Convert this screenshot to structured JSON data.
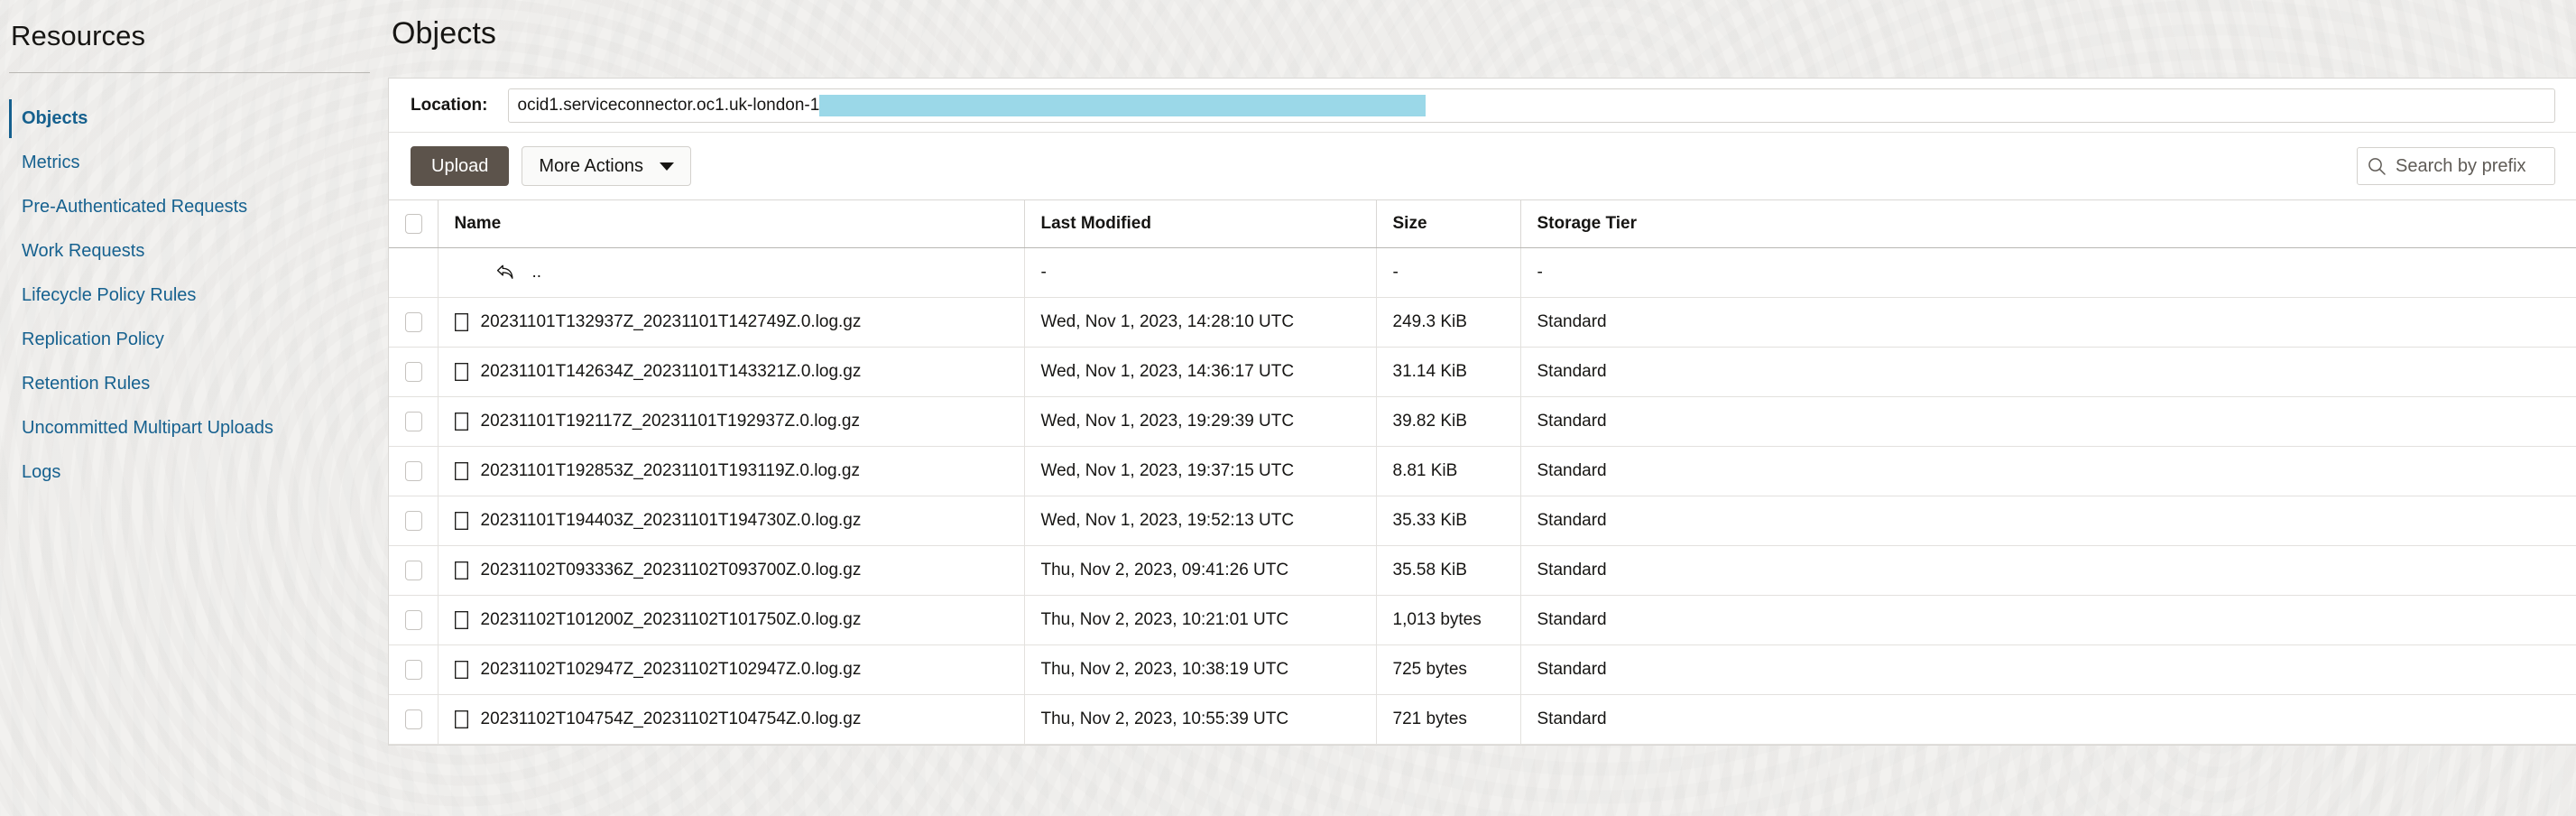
{
  "sidebar": {
    "title": "Resources",
    "items": [
      {
        "label": "Objects",
        "active": true
      },
      {
        "label": "Metrics",
        "active": false
      },
      {
        "label": "Pre-Authenticated Requests",
        "active": false
      },
      {
        "label": "Work Requests",
        "active": false
      },
      {
        "label": "Lifecycle Policy Rules",
        "active": false
      },
      {
        "label": "Replication Policy",
        "active": false
      },
      {
        "label": "Retention Rules",
        "active": false
      },
      {
        "label": "Uncommitted Multipart Uploads",
        "active": false
      },
      {
        "label": "Logs",
        "active": false
      }
    ]
  },
  "main": {
    "page_title": "Objects",
    "location": {
      "label": "Location:",
      "value": "ocid1.serviceconnector.oc1.uk-london-1",
      "redacted": true
    },
    "toolbar": {
      "upload_label": "Upload",
      "more_actions_label": "More Actions",
      "search_placeholder": "Search by prefix"
    },
    "table": {
      "columns": [
        "Name",
        "Last Modified",
        "Size",
        "Storage Tier"
      ],
      "parent_row": {
        "name": "..",
        "last_modified": "-",
        "size": "-",
        "storage_tier": "-"
      },
      "rows": [
        {
          "name": "20231101T132937Z_20231101T142749Z.0.log.gz",
          "last_modified": "Wed, Nov 1, 2023, 14:28:10 UTC",
          "size": "249.3 KiB",
          "storage_tier": "Standard"
        },
        {
          "name": "20231101T142634Z_20231101T143321Z.0.log.gz",
          "last_modified": "Wed, Nov 1, 2023, 14:36:17 UTC",
          "size": "31.14 KiB",
          "storage_tier": "Standard"
        },
        {
          "name": "20231101T192117Z_20231101T192937Z.0.log.gz",
          "last_modified": "Wed, Nov 1, 2023, 19:29:39 UTC",
          "size": "39.82 KiB",
          "storage_tier": "Standard"
        },
        {
          "name": "20231101T192853Z_20231101T193119Z.0.log.gz",
          "last_modified": "Wed, Nov 1, 2023, 19:37:15 UTC",
          "size": "8.81 KiB",
          "storage_tier": "Standard"
        },
        {
          "name": "20231101T194403Z_20231101T194730Z.0.log.gz",
          "last_modified": "Wed, Nov 1, 2023, 19:52:13 UTC",
          "size": "35.33 KiB",
          "storage_tier": "Standard"
        },
        {
          "name": "20231102T093336Z_20231102T093700Z.0.log.gz",
          "last_modified": "Thu, Nov 2, 2023, 09:41:26 UTC",
          "size": "35.58 KiB",
          "storage_tier": "Standard"
        },
        {
          "name": "20231102T101200Z_20231102T101750Z.0.log.gz",
          "last_modified": "Thu, Nov 2, 2023, 10:21:01 UTC",
          "size": "1,013 bytes",
          "storage_tier": "Standard"
        },
        {
          "name": "20231102T102947Z_20231102T102947Z.0.log.gz",
          "last_modified": "Thu, Nov 2, 2023, 10:38:19 UTC",
          "size": "725 bytes",
          "storage_tier": "Standard"
        },
        {
          "name": "20231102T104754Z_20231102T104754Z.0.log.gz",
          "last_modified": "Thu, Nov 2, 2023, 10:55:39 UTC",
          "size": "721 bytes",
          "storage_tier": "Standard"
        }
      ]
    }
  },
  "colors": {
    "page_background": "#f2f1ef",
    "link": "#16618f",
    "upload_button": "#5c534b",
    "redaction_highlight": "#9bd8e8",
    "panel_background": "#ffffff"
  }
}
